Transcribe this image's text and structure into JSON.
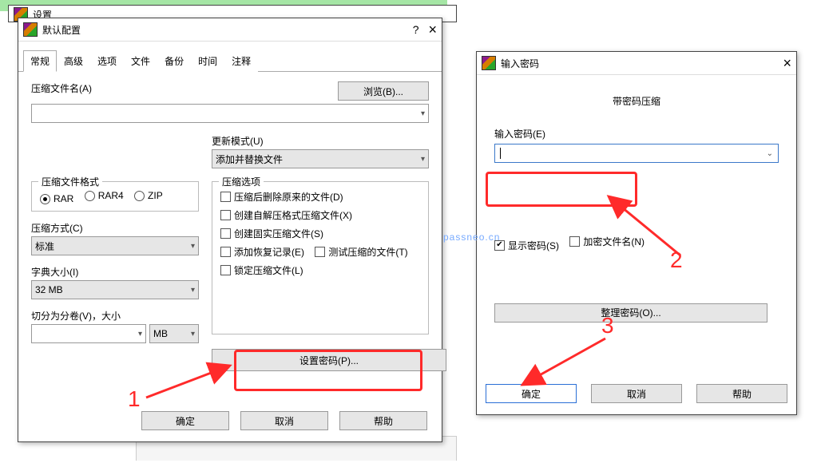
{
  "bg_settings_title": "设置",
  "main": {
    "title": "默认配置",
    "tabs": [
      "常规",
      "高级",
      "选项",
      "文件",
      "备份",
      "时间",
      "注释"
    ],
    "filename_label": "压缩文件名(A)",
    "browse_btn": "浏览(B)...",
    "update_mode_label": "更新模式(U)",
    "update_mode_value": "添加并替换文件",
    "format_group": "压缩文件格式",
    "format_opts": [
      "RAR",
      "RAR4",
      "ZIP"
    ],
    "method_label": "压缩方式(C)",
    "method_value": "标准",
    "dict_label": "字典大小(I)",
    "dict_value": "32 MB",
    "volume_label": "切分为分卷(V)，大小",
    "volume_unit": "MB",
    "options_group": "压缩选项",
    "options": [
      "压缩后删除原来的文件(D)",
      "创建自解压格式压缩文件(X)",
      "创建固实压缩文件(S)",
      "添加恢复记录(E)",
      "测试压缩的文件(T)",
      "锁定压缩文件(L)"
    ],
    "set_pwd_btn": "设置密码(P)...",
    "ok": "确定",
    "cancel": "取消",
    "help": "帮助"
  },
  "pwd": {
    "title": "输入密码",
    "subtitle": "带密码压缩",
    "field_label": "输入密码(E)",
    "show_pwd": "显示密码(S)",
    "enc_names": "加密文件名(N)",
    "organize": "整理密码(O)...",
    "ok": "确定",
    "cancel": "取消",
    "help": "帮助"
  },
  "annot": {
    "n1": "1",
    "n2": "2",
    "n3": "3"
  },
  "watermark": "passneo.cn"
}
